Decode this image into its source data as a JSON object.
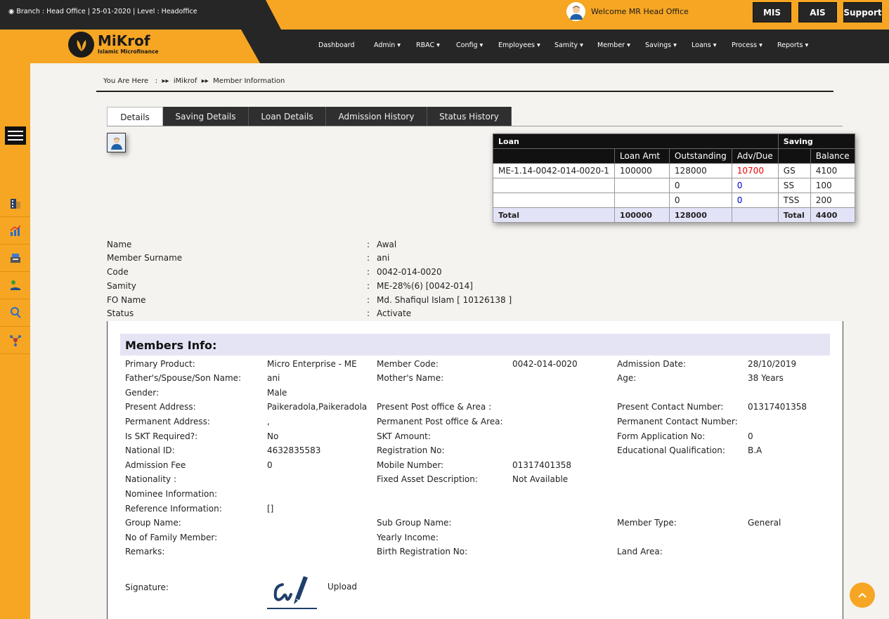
{
  "topbar": {
    "info": "Branch : Head Office |  25-01-2020 | Level : Headoffice",
    "welcome": "Welcome MR Head Office",
    "buttons": {
      "mis": "MIS",
      "ais": "AIS",
      "support": "Support"
    }
  },
  "logo": {
    "name": "MiKrof",
    "tagline": "Islamic Microfinance"
  },
  "nav": {
    "dashboard": "Dashboard",
    "admin": "Admin",
    "rbac": "RBAC",
    "config": "Config",
    "employees": "Employees",
    "samity": "Samity",
    "member": "Member",
    "savings": "Savings",
    "loans": "Loans",
    "process": "Process",
    "reports": "Reports"
  },
  "breadcrumb": {
    "label": "You Are Here",
    "sep": ":",
    "home": "iMikrof",
    "current": "Member Information"
  },
  "tabs": {
    "details": "Details",
    "saving_details": "Saving Details",
    "loan_details": "Loan Details",
    "admission_history": "Admission History",
    "status_history": "Status History"
  },
  "loan_table": {
    "loan_header": "Loan",
    "saving_header": "Saving",
    "cols": {
      "loan_amt": "Loan Amt",
      "outstanding": "Outstanding",
      "adv_due": "Adv/Due",
      "balance": "Balance"
    },
    "rows": [
      {
        "code": "ME-1.14-0042-014-0020-1",
        "loan_amt": "100000",
        "outstanding": "128000",
        "adv_due": "10700",
        "saving_type": "GS",
        "balance": "4100"
      },
      {
        "code": "",
        "loan_amt": "",
        "outstanding": "0",
        "adv_due": "0",
        "saving_type": "SS",
        "balance": "100"
      },
      {
        "code": "",
        "loan_amt": "",
        "outstanding": "0",
        "adv_due": "0",
        "saving_type": "TSS",
        "balance": "200"
      }
    ],
    "total": {
      "label": "Total",
      "loan_amt": "100000",
      "outstanding": "128000",
      "saving_label": "Total",
      "balance": "4400"
    }
  },
  "summary": [
    {
      "label": "Name",
      "value": "Awal"
    },
    {
      "label": "Member Surname",
      "value": "ani"
    },
    {
      "label": "Code",
      "value": "0042-014-0020"
    },
    {
      "label": "Samity",
      "value": "ME-28%(6) [0042-014]"
    },
    {
      "label": "FO Name",
      "value": "Md. Shafiqul Islam [ 10126138 ]"
    },
    {
      "label": "Status",
      "value": "Activate"
    }
  ],
  "members_info": {
    "title": "Members Info:",
    "primary_product_label": "Primary Product:",
    "primary_product": "Micro Enterprise - ME",
    "member_code_label": "Member Code:",
    "member_code": "0042-014-0020",
    "admission_date_label": "Admission Date:",
    "admission_date": "28/10/2019",
    "father_label": "Father's/Spouse/Son Name:",
    "father": "ani",
    "mother_label": "Mother's Name:",
    "age_label": "Age:",
    "age": "38 Years",
    "gender_label": "Gender:",
    "gender": "Male",
    "present_address_label": "Present Address:",
    "present_address": "Paikeradola,Paikeradola",
    "present_post_label": "Present Post office & Area :",
    "present_contact_label": "Present Contact Number:",
    "present_contact": "01317401358",
    "permanent_address_label": "Permanent Address:",
    "permanent_address": ",",
    "permanent_post_label": "Permanent Post office & Area:",
    "permanent_contact_label": "Permanent Contact Number:",
    "skt_required_label": "Is SKT Required?:",
    "skt_required": "No",
    "skt_amount_label": "SKT Amount:",
    "form_app_label": "Form Application No:",
    "form_app": "0",
    "national_id_label": "National ID:",
    "national_id": "4632835583",
    "registration_label": "Registration No:",
    "education_label": "Educational Qualification:",
    "education": "B.A",
    "admission_fee_label": "Admission Fee",
    "admission_fee": "0",
    "mobile_label": "Mobile Number:",
    "mobile": "01317401358",
    "nationality_label": "Nationality :",
    "fixed_asset_label": "Fixed Asset Description:",
    "fixed_asset": "Not Available",
    "nominee_label": "Nominee Information:",
    "reference_label": "Reference Information:",
    "reference": "[]",
    "group_label": "Group Name:",
    "sub_group_label": "Sub Group Name:",
    "member_type_label": "Member Type:",
    "member_type": "General",
    "family_label": "No of Family Member:",
    "yearly_income_label": "Yearly Income:",
    "remarks_label": "Remarks:",
    "birth_reg_label": "Birth Registration No:",
    "land_area_label": "Land Area:",
    "signature_label": "Signature:",
    "upload_label": "Upload"
  },
  "icons": [
    "globe-icon",
    "clock-icon",
    "user-avatar-icon",
    "hamburger-icon",
    "building-icon",
    "chart-icon",
    "cash-register-icon",
    "hand-money-icon",
    "search-person-icon",
    "network-icon",
    "signature-icon",
    "chevron-up-icon"
  ],
  "colors": {
    "accent": "#f6a623",
    "dark": "#262626",
    "due_red": "#e00000",
    "zero_blue": "#0000cc"
  }
}
